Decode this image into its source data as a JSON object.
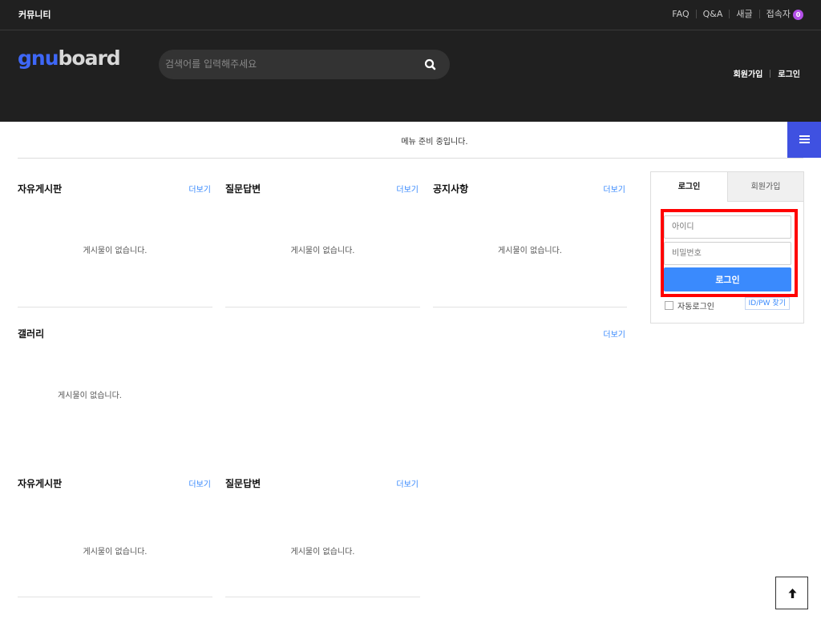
{
  "topbar": {
    "community": "커뮤니티",
    "links": [
      "FAQ",
      "Q&A",
      "새글",
      "접속자"
    ],
    "visitor_count": "0"
  },
  "header": {
    "logo_part1": "gnu",
    "logo_part2": "board",
    "search_placeholder": "검색어를 입력해주세요",
    "join": "회원가입",
    "login": "로그인"
  },
  "menu": {
    "status_text": "메뉴 준비 중입니다."
  },
  "boards": {
    "more_label": "더보기",
    "empty_text": "게시물이 없습니다.",
    "items": [
      {
        "title": "자유게시판"
      },
      {
        "title": "질문답변"
      },
      {
        "title": "공지사항"
      },
      {
        "title": "갤러리"
      },
      {
        "title": "자유게시판"
      },
      {
        "title": "질문답변"
      }
    ]
  },
  "login": {
    "tab_login": "로그인",
    "tab_join": "회원가입",
    "id_placeholder": "아이디",
    "pw_placeholder": "비밀번호",
    "submit": "로그인",
    "auto_login": "자동로그인",
    "find": "ID/PW 찾기"
  },
  "colors": {
    "header_bg": "#202020",
    "accent_blue": "#3a8afd",
    "menu_button": "#3f51e1",
    "highlight": "#ff0000"
  }
}
